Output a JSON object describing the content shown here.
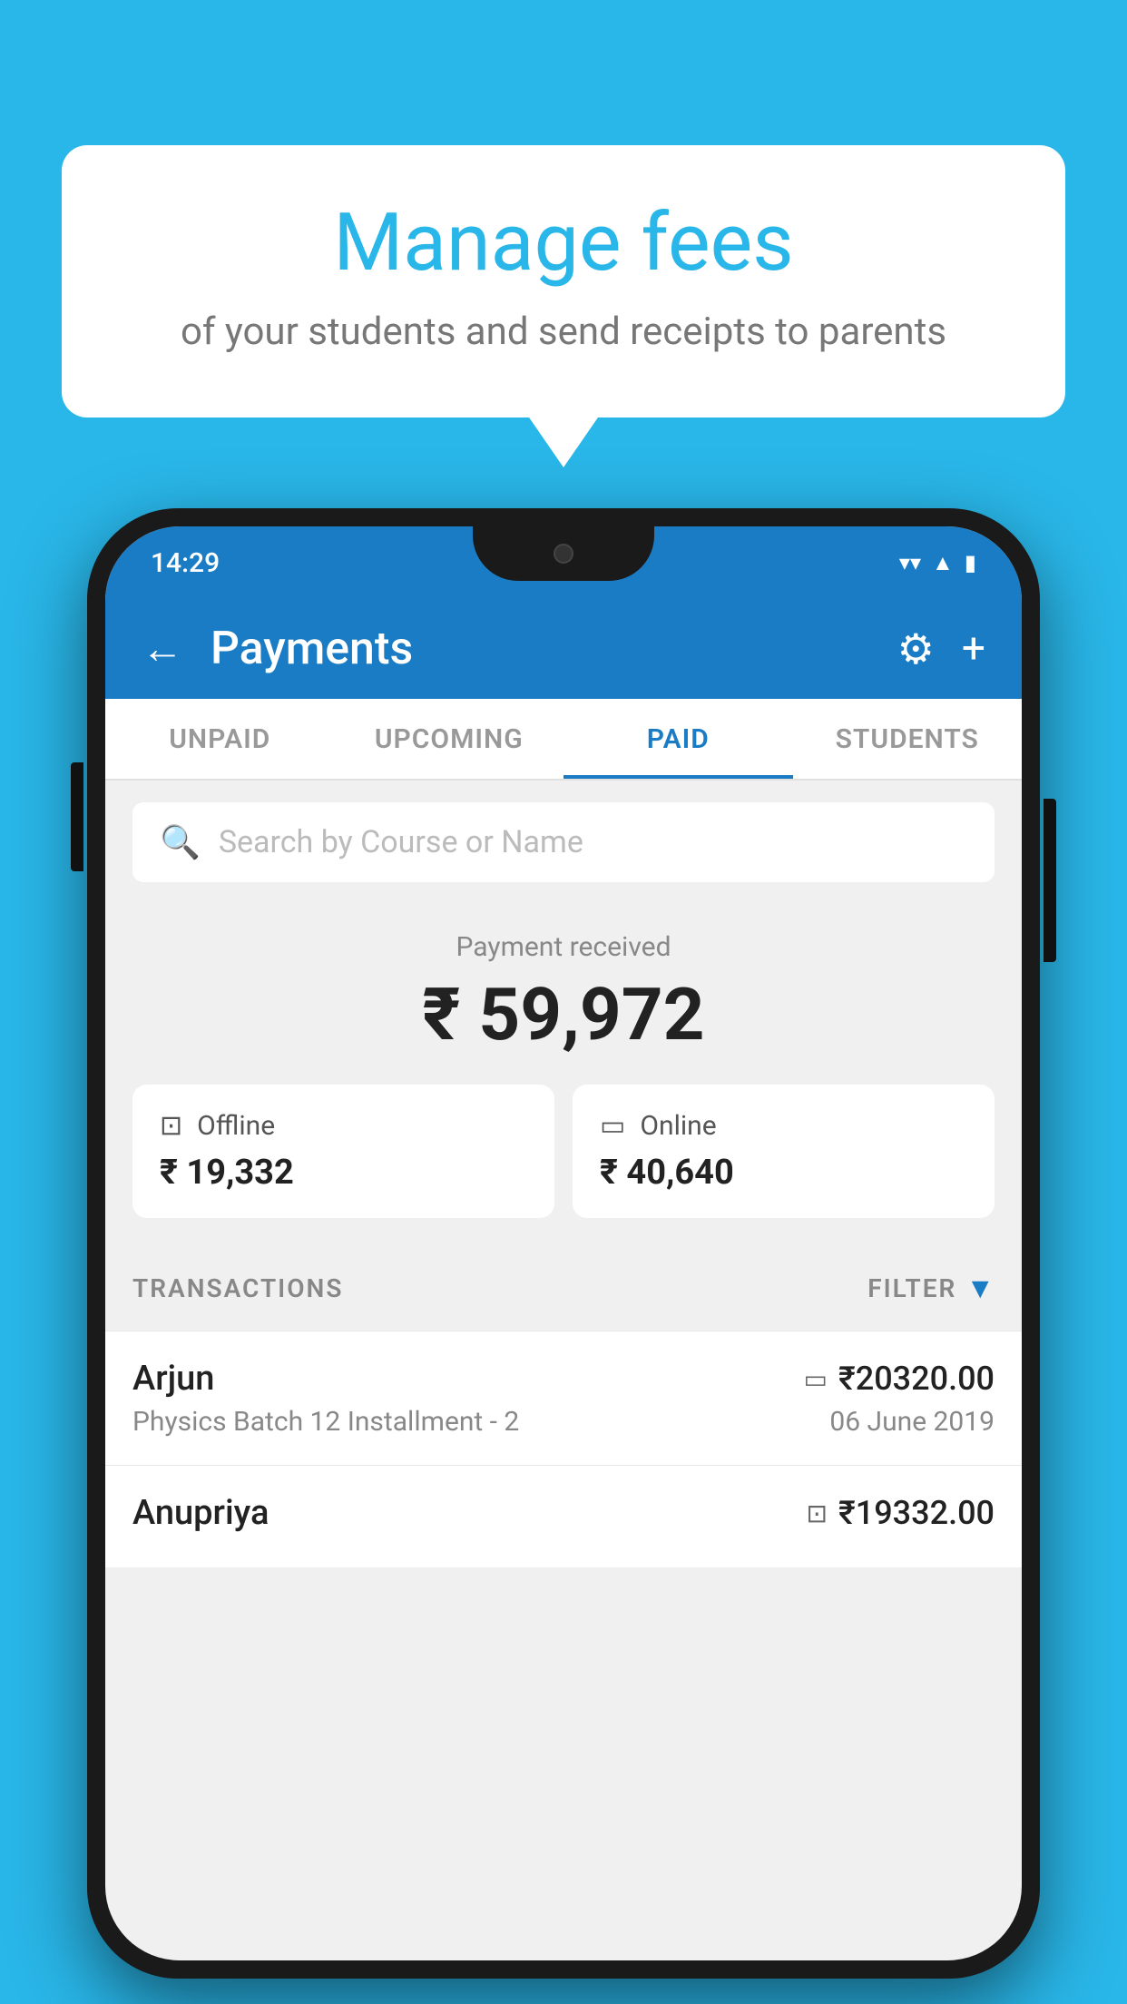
{
  "background": {
    "color": "#29b6e8"
  },
  "speech_bubble": {
    "title": "Manage fees",
    "subtitle": "of your students and send receipts to parents"
  },
  "status_bar": {
    "time": "14:29"
  },
  "header": {
    "title": "Payments",
    "back_label": "←",
    "gear_symbol": "⚙",
    "plus_symbol": "+"
  },
  "tabs": [
    {
      "label": "UNPAID",
      "active": false
    },
    {
      "label": "UPCOMING",
      "active": false
    },
    {
      "label": "PAID",
      "active": true
    },
    {
      "label": "STUDENTS",
      "active": false
    }
  ],
  "search": {
    "placeholder": "Search by Course or Name"
  },
  "payment_received": {
    "label": "Payment received",
    "amount": "₹ 59,972",
    "offline": {
      "label": "Offline",
      "amount": "₹ 19,332"
    },
    "online": {
      "label": "Online",
      "amount": "₹ 40,640"
    }
  },
  "transactions": {
    "section_label": "TRANSACTIONS",
    "filter_label": "FILTER",
    "items": [
      {
        "name": "Arjun",
        "course": "Physics Batch 12 Installment - 2",
        "amount": "₹20320.00",
        "date": "06 June 2019",
        "method": "online"
      },
      {
        "name": "Anupriya",
        "course": "",
        "amount": "₹19332.00",
        "date": "",
        "method": "offline"
      }
    ]
  }
}
